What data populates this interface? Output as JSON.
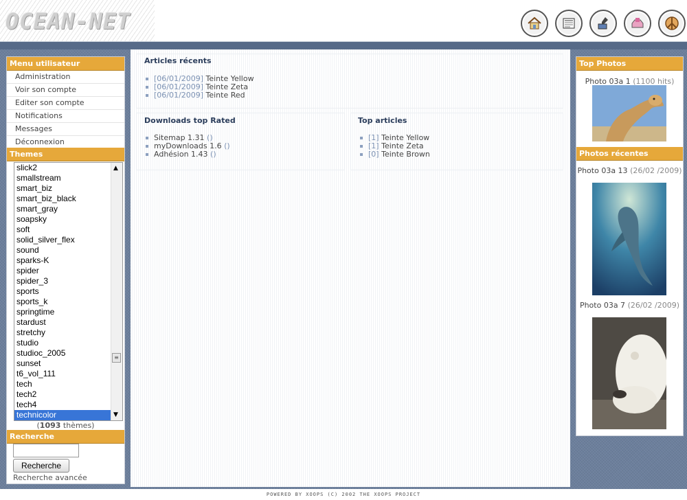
{
  "site": {
    "logo_text": "OCEAN-NET"
  },
  "nav_icons": [
    "home-icon",
    "news-icon",
    "download-icon",
    "inbox-icon",
    "peace-icon"
  ],
  "left": {
    "user_menu": {
      "title": "Menu utilisateur",
      "items": [
        "Administration",
        "Voir son compte",
        "Editer son compte",
        "Notifications",
        "Messages",
        "Déconnexion"
      ]
    },
    "themes": {
      "title": "Themes",
      "options": [
        "slick2",
        "smallstream",
        "smart_biz",
        "smart_biz_black",
        "smart_gray",
        "soapsky",
        "soft",
        "solid_silver_flex",
        "sound",
        "sparks-K",
        "spider",
        "spider_3",
        "sports",
        "sports_k",
        "springtime",
        "stardust",
        "stretchy",
        "studio",
        "studioc_2005",
        "sunset",
        "t6_vol_111",
        "tech",
        "tech2",
        "tech4",
        "technicolor"
      ],
      "selected": "technicolor",
      "count_prefix": "(",
      "count": "1093",
      "count_suffix": " thèmes)"
    },
    "search": {
      "title": "Recherche",
      "input_value": "",
      "button": "Recherche",
      "advanced": "Recherche avancée"
    }
  },
  "center": {
    "recent_articles": {
      "title": "Articles récents",
      "items": [
        {
          "date": "[06/01/2009]",
          "label": "Teinte Yellow"
        },
        {
          "date": "[06/01/2009]",
          "label": "Teinte Zeta"
        },
        {
          "date": "[06/01/2009]",
          "label": "Teinte Red"
        }
      ]
    },
    "downloads_top": {
      "title": "Downloads top Rated",
      "items": [
        {
          "label": "Sitemap 1.31",
          "extra": "()"
        },
        {
          "label": "myDownloads 1.6",
          "extra": "()"
        },
        {
          "label": "Adhésion 1.43",
          "extra": "()"
        }
      ]
    },
    "top_articles": {
      "title": "Top articles",
      "items": [
        {
          "count": "[1]",
          "label": "Teinte Yellow"
        },
        {
          "count": "[1]",
          "label": "Teinte Zeta"
        },
        {
          "count": "[0]",
          "label": "Teinte Brown"
        }
      ]
    }
  },
  "right": {
    "top_photos": {
      "title": "Top Photos",
      "photo": {
        "name": "Photo 03a 1",
        "meta": "(1100 hits)",
        "image": "camel-photo"
      }
    },
    "recent_photos": {
      "title": "Photos récentes",
      "photos": [
        {
          "name": "Photo 03a 13",
          "meta": "(26/02 /2009)",
          "image": "dolphin-photo"
        },
        {
          "name": "Photo 03a 7",
          "meta": "(26/02 /2009)",
          "image": "polar-bear-photo"
        }
      ]
    }
  },
  "footer": {
    "text": "POWERED BY XOOPS (C) 2002 THE XOOPS PROJECT"
  }
}
